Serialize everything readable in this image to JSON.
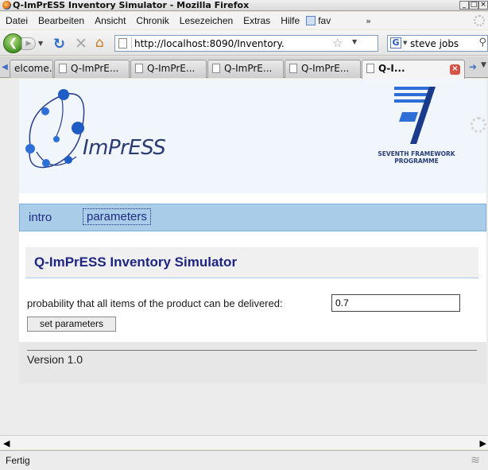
{
  "window": {
    "title": "Q-ImPrESS Inventory Simulator - Mozilla Firefox",
    "buttons": [
      "_",
      "□",
      "×"
    ]
  },
  "menubar": {
    "items": [
      "Datei",
      "Bearbeiten",
      "Ansicht",
      "Chronik",
      "Lesezeichen",
      "Extras",
      "Hilfe"
    ],
    "fav_label": "fav",
    "overflow": "»"
  },
  "navbar": {
    "url": "http://localhost:8090/Inventory.",
    "search_value": "steve jobs",
    "search_engine": "G"
  },
  "tabs": {
    "items": [
      {
        "label": "elcome..."
      },
      {
        "label": "Q-ImPrE..."
      },
      {
        "label": "Q-ImPrE..."
      },
      {
        "label": "Q-ImPrE..."
      },
      {
        "label": "Q-ImPrE..."
      },
      {
        "label": "Q-I..."
      }
    ],
    "active_index": 5
  },
  "page": {
    "logo_text": "ImPrESS",
    "fp7_line1": "SEVENTH FRAMEWORK",
    "fp7_line2": "PROGRAMME",
    "nav": {
      "intro": "intro",
      "parameters": "parameters"
    },
    "app_title": "Q-ImPrESS Inventory Simulator",
    "form": {
      "probability_label": "probability that all items of the product can be delivered:",
      "probability_value": "0.7",
      "submit_label": "set parameters"
    },
    "version": "Version 1.0"
  },
  "statusbar": {
    "text": "Fertig"
  },
  "colors": {
    "nav_strip": "#a9cde9",
    "title_text": "#1d2580",
    "header_bg": "#f1f6fc"
  }
}
